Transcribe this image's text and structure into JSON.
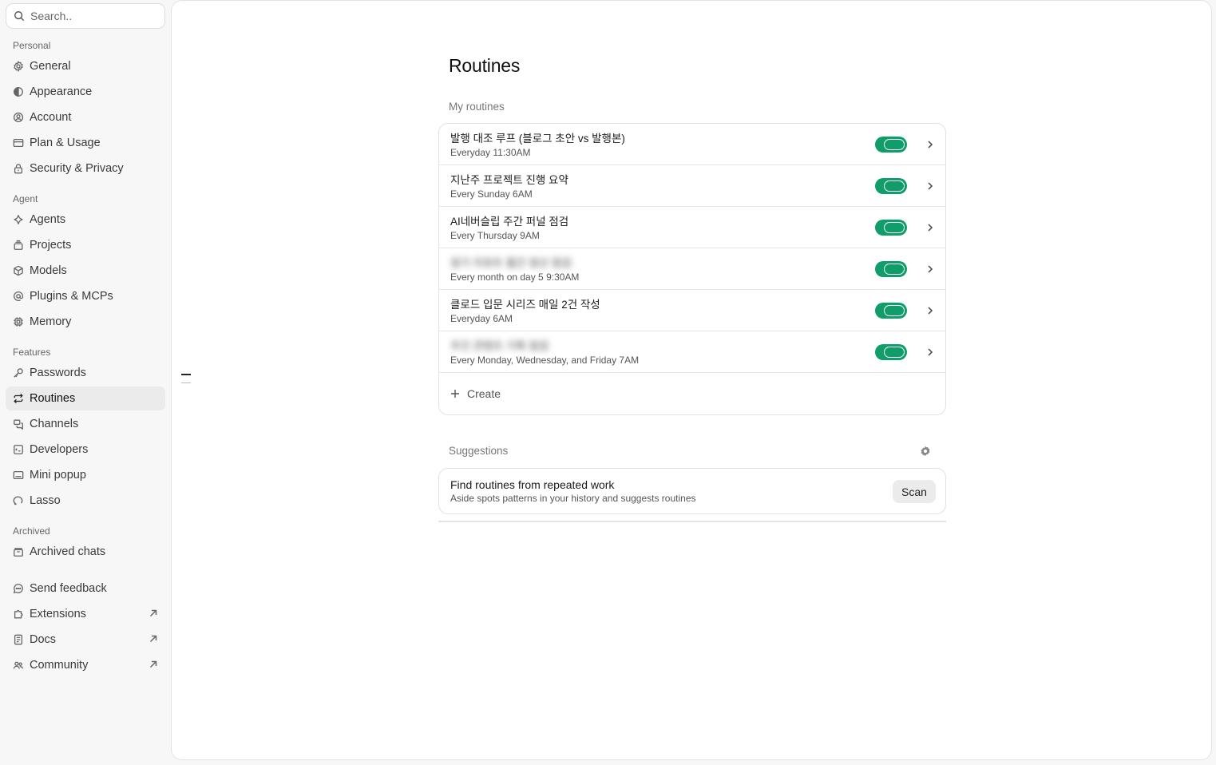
{
  "search": {
    "placeholder": "Search.."
  },
  "sidebar": {
    "sections": {
      "personal": "Personal",
      "agent": "Agent",
      "features": "Features",
      "archived": "Archived"
    },
    "personal_items": [
      {
        "label": "General",
        "icon": "gear-icon"
      },
      {
        "label": "Appearance",
        "icon": "contrast-icon"
      },
      {
        "label": "Account",
        "icon": "user-circle-icon"
      },
      {
        "label": "Plan & Usage",
        "icon": "card-icon"
      },
      {
        "label": "Security & Privacy",
        "icon": "lock-icon"
      }
    ],
    "agent_items": [
      {
        "label": "Agents",
        "icon": "sparkle-icon"
      },
      {
        "label": "Projects",
        "icon": "stack-icon"
      },
      {
        "label": "Models",
        "icon": "cube-icon"
      },
      {
        "label": "Plugins & MCPs",
        "icon": "at-icon"
      },
      {
        "label": "Memory",
        "icon": "chip-icon"
      }
    ],
    "feature_items": [
      {
        "label": "Passwords",
        "icon": "key-icon"
      },
      {
        "label": "Routines",
        "icon": "repeat-icon",
        "active": true
      },
      {
        "label": "Channels",
        "icon": "channels-icon"
      },
      {
        "label": "Developers",
        "icon": "code-icon"
      },
      {
        "label": "Mini popup",
        "icon": "window-icon"
      },
      {
        "label": "Lasso",
        "icon": "lasso-icon"
      }
    ],
    "archived_items": [
      {
        "label": "Archived chats",
        "icon": "archive-icon"
      }
    ],
    "footer_items": [
      {
        "label": "Send feedback",
        "icon": "chat-bubble-icon"
      },
      {
        "label": "Extensions",
        "icon": "puzzle-icon",
        "external": true
      },
      {
        "label": "Docs",
        "icon": "book-icon",
        "external": true
      },
      {
        "label": "Community",
        "icon": "people-icon",
        "external": true
      }
    ]
  },
  "main": {
    "title": "Routines",
    "my_routines_label": "My routines",
    "routines": [
      {
        "title": "발행 대조 루프 (블로그 초안 vs 발행본)",
        "schedule": "Everyday 11:30AM",
        "enabled": true,
        "blurred": false
      },
      {
        "title": "지난주 프로젝트 진행 요약",
        "schedule": "Every Sunday 6AM",
        "enabled": true,
        "blurred": false
      },
      {
        "title": "AI네버슬립 주간 퍼널 점검",
        "schedule": "Every Thursday 9AM",
        "enabled": true,
        "blurred": false
      },
      {
        "title": "정기 리포트 월간 정산 점검",
        "schedule": "Every month on day 5 9:30AM",
        "enabled": true,
        "blurred": true
      },
      {
        "title": "클로드 입문 시리즈 매일 2건 작성",
        "schedule": "Everyday 6AM",
        "enabled": true,
        "blurred": false
      },
      {
        "title": "주간 콘텐츠 기획 점검",
        "schedule": "Every Monday, Wednesday, and Friday 7AM",
        "enabled": true,
        "blurred": true
      }
    ],
    "create_label": "Create",
    "suggestions_label": "Suggestions",
    "suggestion": {
      "title": "Find routines from repeated work",
      "subtitle": "Aside spots patterns in your history and suggests routines",
      "button": "Scan"
    }
  },
  "colors": {
    "toggle_on": "#0f9d6a",
    "active_nav_bg": "#ebebeb"
  }
}
